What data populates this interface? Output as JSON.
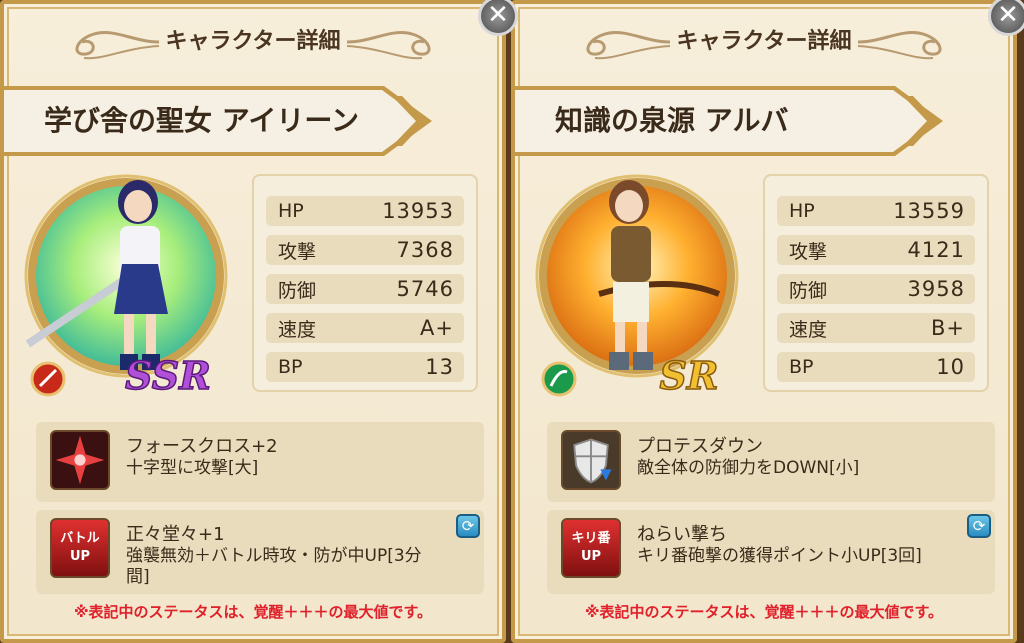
{
  "note_text": "※表記中のステータスは、覚醒＋＋＋の最大値です。",
  "cards": [
    {
      "header": "キャラクター詳細",
      "name": "学び舎の聖女 アイリーン",
      "rarity": "SSR",
      "element_icon": "sword-icon",
      "stats": [
        {
          "label": "HP",
          "value": "13953"
        },
        {
          "label": "攻撃",
          "value": "7368"
        },
        {
          "label": "防御",
          "value": "5746"
        },
        {
          "label": "速度",
          "value": "A+"
        },
        {
          "label": "BP",
          "value": "13"
        }
      ],
      "skill1": {
        "icon": "cross-star-icon",
        "title": "フォースクロス+2",
        "desc": "十字型に攻撃[大]"
      },
      "skill2": {
        "icon_text": "バトル\nUP",
        "title": "正々堂々+1",
        "desc": "強襲無効＋バトル時攻・防が中UP[3分間]"
      }
    },
    {
      "header": "キャラクター詳細",
      "name": "知識の泉源 アルバ",
      "rarity": "SR",
      "element_icon": "bow-icon",
      "stats": [
        {
          "label": "HP",
          "value": "13559"
        },
        {
          "label": "攻撃",
          "value": "4121"
        },
        {
          "label": "防御",
          "value": "3958"
        },
        {
          "label": "速度",
          "value": "B+"
        },
        {
          "label": "BP",
          "value": "10"
        }
      ],
      "skill1": {
        "icon": "shield-down-icon",
        "title": "プロテスダウン",
        "desc": "敵全体の防御力をDOWN[小]"
      },
      "skill2": {
        "icon_text": "キリ番\nUP",
        "title": "ねらい撃ち",
        "desc": "キリ番砲撃の獲得ポイント小UP[3回]"
      }
    }
  ]
}
